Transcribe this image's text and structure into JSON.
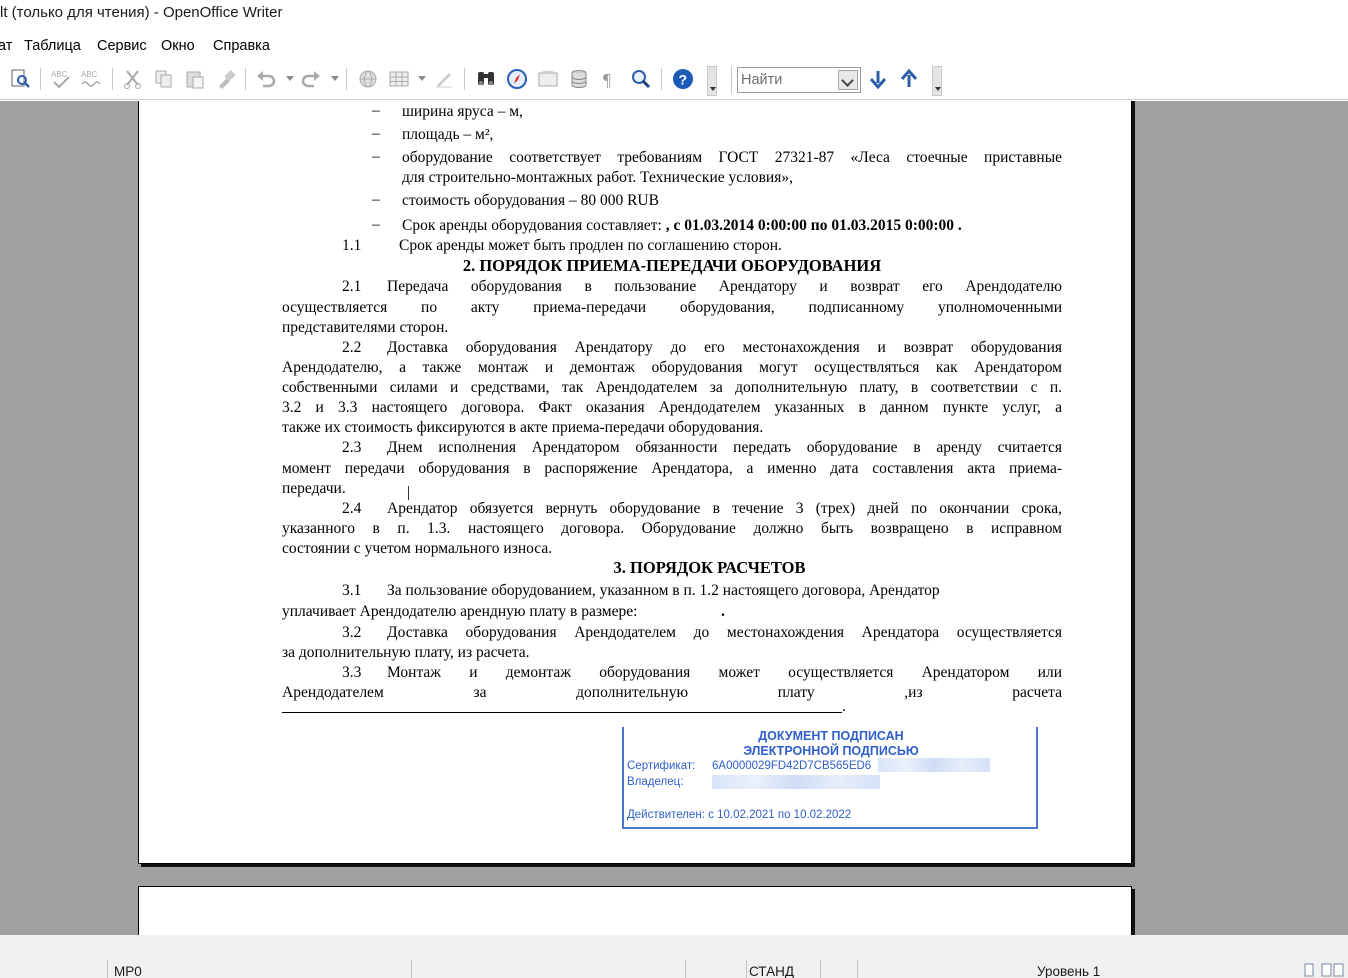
{
  "window": {
    "title": "lt (только для чтения) - OpenOffice Writer"
  },
  "menu": {
    "items": [
      {
        "label": "ат"
      },
      {
        "label": "Таблица"
      },
      {
        "label": "Сервис"
      },
      {
        "label": "Окно"
      },
      {
        "label": "Справка"
      }
    ]
  },
  "toolbar": {
    "search_placeholder": "Найти",
    "icons": [
      "page-preview",
      "spellcheck",
      "autospellcheck",
      "cut",
      "copy",
      "paste",
      "format-paintbrush",
      "undo",
      "redo",
      "hyperlink",
      "table",
      "draw-functions",
      "find-replace",
      "navigator",
      "gallery",
      "data-sources",
      "nonprinting-characters",
      "zoom",
      "help",
      "find-next",
      "find-previous"
    ]
  },
  "document": {
    "bullets": [
      {
        "marker": "–",
        "text": "ширина яруса –  м,"
      },
      {
        "marker": "–",
        "text": "площадь  –  м², "
      },
      {
        "marker": "–",
        "line1": "оборудование соответствует требованиям ГОСТ 27321-87 «Леса стоечные приставные",
        "line2": "для строительно-монтажных работ. Технические условия»,"
      },
      {
        "marker": "–",
        "text": "стоимость оборудования – 80 000 RUB"
      },
      {
        "marker": "–",
        "text_plain": "Срок аренды оборудования  составляет: ",
        "text_bold": " ,  с 01.03.2014 0:00:00 по 01.03.2015 0:00:00 ."
      }
    ],
    "p_1_1": {
      "num": "1.1",
      "text": "Срок аренды может быть продлен по соглашению сторон."
    },
    "section2_heading": "2. ПОРЯДОК ПРИЕМА-ПЕРЕДАЧИ ОБОРУДОВАНИЯ",
    "p_2_1": {
      "num": "2.1",
      "line1": "Передача оборудования в пользование Арендатору и возврат его Арендодателю",
      "line2": "осуществляется по акту приема-передачи оборудования, подписанному уполномоченными",
      "line3": "представителями сторон."
    },
    "p_2_2": {
      "num": "2.2",
      "line1": "Доставка оборудования Арендатору  до его местонахождения  и возврат оборудования",
      "line2": "Арендодателю, а также  монтаж и демонтаж оборудования могут осуществляться как Арендатором",
      "line3": "собственными силами и средствами, так Арендодателем за дополнительную плату, в соответствии с п.",
      "line4": "3.2 и 3.3 настоящего договора. Факт оказания Арендодателем указанных в данном пункте услуг, а",
      "line5": "также их стоимость фиксируются в акте приема-передачи оборудования."
    },
    "p_2_3": {
      "num": "2.3",
      "line1": "Днем исполнения Арендатором обязанности передать оборудование в аренду считается",
      "line2": "момент передачи оборудования в распоряжение Арендатора, а именно дата составления акта приема-",
      "line3": "передачи."
    },
    "p_2_4": {
      "num": "2.4",
      "line1": "Арендатор обязуется вернуть оборудование в течение 3 (трех) дней по окончании срока,",
      "line2": "указанного в п. 1.3. настоящего договора. Оборудование должно быть возвращено в исправном",
      "line3": "состоянии с учетом нормального износа."
    },
    "section3_heading": "3. ПОРЯДОК РАСЧЕТОВ",
    "p_3_1": {
      "num": "3.1",
      "line1": "За пользование оборудованием, указанном в п. 1.2 настоящего договора, Арендатор",
      "line2": "уплачивает Арендодателю арендную плату в размере:",
      "line2_tail": "."
    },
    "p_3_2": {
      "num": "3.2",
      "line1": "Доставка оборудования Арендодателем до местонахождения Арендатора осуществляется",
      "line2": "за дополнительную плату, из расчета."
    },
    "p_3_3": {
      "num": "3.3",
      "line1": "Монтаж и демонтаж оборудования может осуществляется Арендатором или",
      "line2": "Арендодателем за дополнительную плату ,из расчета",
      "line3_tail": "."
    }
  },
  "signature_stamp": {
    "title_line1": "ДОКУМЕНТ ПОДПИСАН",
    "title_line2": "ЭЛЕКТРОННОЙ ПОДПИСЬЮ",
    "certificate_label": "Сертификат:",
    "certificate_value": "6A0000029FD42D7CB565ED6",
    "owner_label": "Владелец:",
    "validity": "Действителен: с 10.02.2021 по 10.02.2022",
    "color": "#2f5fc8"
  },
  "statusbar": {
    "page_style": "МР0",
    "insert_mode": "СТАНД",
    "outline_level": "Уровень 1"
  }
}
